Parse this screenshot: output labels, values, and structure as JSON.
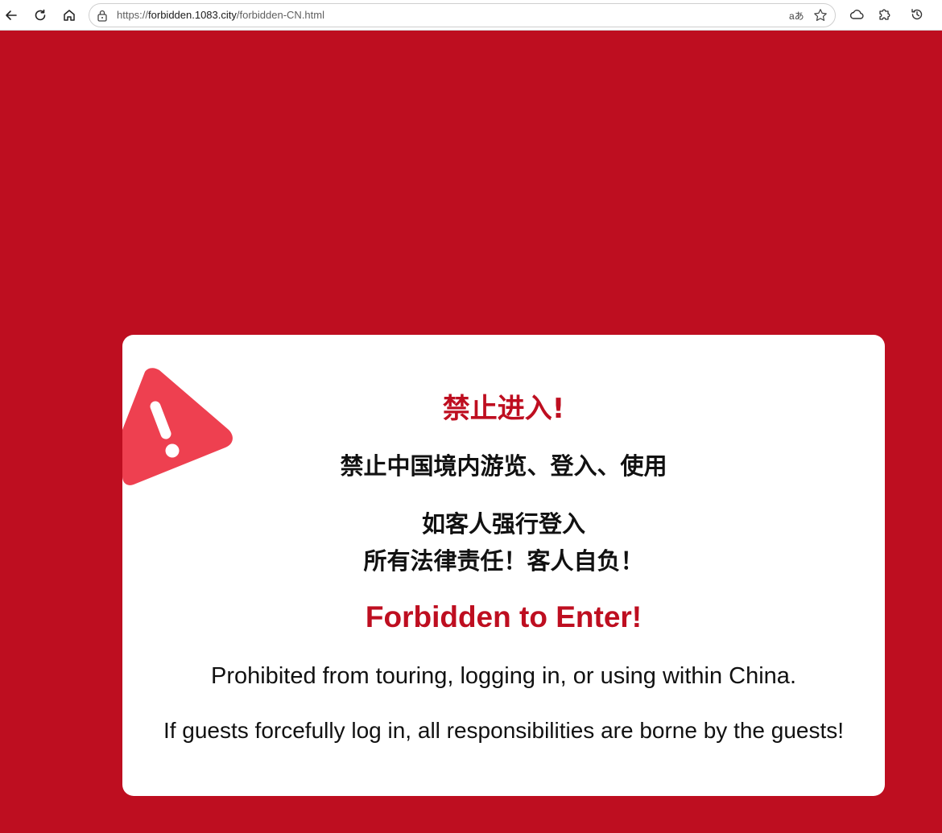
{
  "browser": {
    "url_prefix": "https://",
    "url_host": "forbidden.1083.city",
    "url_path": "/forbidden-CN.html",
    "read_aloud_label": "aあ",
    "icons": [
      "back-icon",
      "reload-icon",
      "home-icon",
      "lock-icon",
      "read-aloud-icon",
      "star-icon",
      "cloud-icon",
      "extensions-icon",
      "history-icon"
    ]
  },
  "notice": {
    "cn_title": "禁止进入!",
    "cn_line1": "禁止中国境内游览、登入、使用",
    "cn_line2": "如客人强行登入",
    "cn_line3": "所有法律责任！客人自负！",
    "en_title": "Forbidden to Enter!",
    "en_line1": "Prohibited from touring, logging in, or using within China.",
    "en_line2": "If guests forcefully log in, all responsibilities are borne by the guests!"
  },
  "colors": {
    "background": "#be0e20",
    "accent_red": "#be0e20",
    "warning_icon": "#ee4050",
    "card": "#ffffff"
  }
}
